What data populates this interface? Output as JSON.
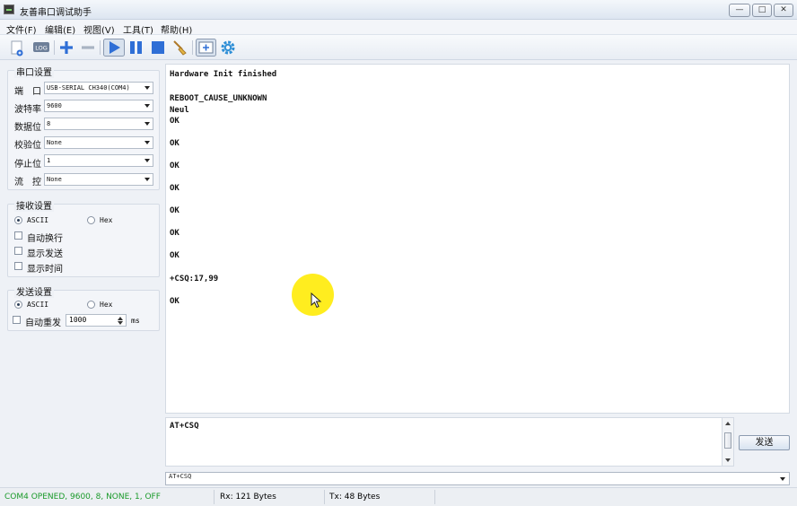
{
  "window": {
    "title": "友善串口调试助手",
    "controls": {
      "minimize": "—",
      "maximize": "□",
      "close": "✕"
    }
  },
  "menu": [
    "文件(F)",
    "编辑(E)",
    "视图(V)",
    "工具(T)",
    "帮助(H)"
  ],
  "toolbar": {
    "log_label": "LOG"
  },
  "serial_settings": {
    "title": "串口设置",
    "fields": [
      {
        "label": "端　口",
        "value": "USB-SERIAL CH340(COM4)"
      },
      {
        "label": "波特率",
        "value": "9600"
      },
      {
        "label": "数据位",
        "value": "8"
      },
      {
        "label": "校验位",
        "value": "None"
      },
      {
        "label": "停止位",
        "value": "1"
      },
      {
        "label": "流　控",
        "value": "None"
      }
    ]
  },
  "receive_settings": {
    "title": "接收设置",
    "modes": [
      "ASCII",
      "Hex"
    ],
    "selected_mode": "ASCII",
    "options": [
      "自动换行",
      "显示发送",
      "显示时间"
    ]
  },
  "send_settings": {
    "title": "发送设置",
    "modes": [
      "ASCII",
      "Hex"
    ],
    "selected_mode": "ASCII",
    "auto_resend_label": "自动重发",
    "interval": "1000",
    "interval_unit": "ms"
  },
  "receive_lines": [
    "Hardware Init finished",
    "REBOOT_CAUSE_UNKNOWN",
    "Neul",
    "OK",
    "OK",
    "OK",
    "OK",
    "OK",
    "OK",
    "OK",
    "+CSQ:17,99",
    "OK"
  ],
  "send_input": {
    "value": "AT+CSQ"
  },
  "send_button": "发送",
  "history": {
    "value": "AT+CSQ"
  },
  "status": {
    "connection": "COM4 OPENED, 9600, 8, NONE, 1, OFF",
    "rx": "Rx: 121 Bytes",
    "tx": "Tx: 48 Bytes"
  },
  "colors": {
    "status_connection": "#1a9a2a",
    "cursor_highlight": "#ffeb00",
    "toolbar_accent": "#2f6fd6"
  }
}
